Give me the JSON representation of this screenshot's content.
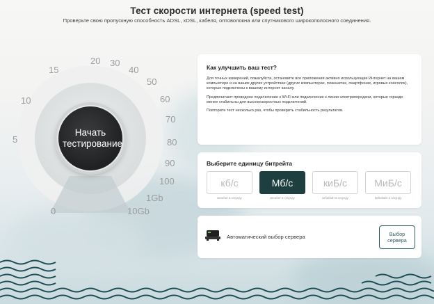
{
  "header": {
    "title": "Тест скорости интернета (speed test)",
    "subtitle": "Проверьте свою пропускную способность ADSL, xDSL, кабеля, оптоволокна или спутникового широкополосного соединения."
  },
  "gauge": {
    "start_label": "Начать тестирование",
    "ticks": [
      "0",
      "5",
      "10",
      "15",
      "20",
      "30",
      "40",
      "50",
      "60",
      "70",
      "80",
      "90",
      "100",
      "1Gb",
      "10Gb"
    ]
  },
  "tips": {
    "title": "Как улучшить ваш тест?",
    "paragraphs": [
      "Для точных измерений, пожалуйста, остановите все приложения активно использующие Интернет на вашем компьютере и на ваших других устройствах (других компьютерах, планшетах, смартфонах, игровых консолях), которые подключены к вашему интернет каналу.",
      "Предпочитают проводное подключение к Wi-Fi или подключение к линии электропередачи, которые гораздо менее стабильны для высокоскоростных подключений.",
      "Повторите тест несколько раз, чтобы проверить стабильность результатов."
    ]
  },
  "bitrate": {
    "title": "Выберите единицу битрейта",
    "units": [
      {
        "label": "кб/с",
        "caption": "килобит в секунду",
        "active": false
      },
      {
        "label": "Мб/с",
        "caption": "мегабит в секунду",
        "active": true
      },
      {
        "label": "киБ/с",
        "caption": "кибибайт в секунду",
        "active": false
      },
      {
        "label": "МиБ/с",
        "caption": "мебибайт в секунду",
        "active": false
      }
    ]
  },
  "server": {
    "icon": "server-icon",
    "label": "Автоматический выбор сервера",
    "button_label": "Выбор сервера"
  },
  "colors": {
    "accent": "#1e3f3f",
    "gauge_arc": "#7fb6c0"
  }
}
